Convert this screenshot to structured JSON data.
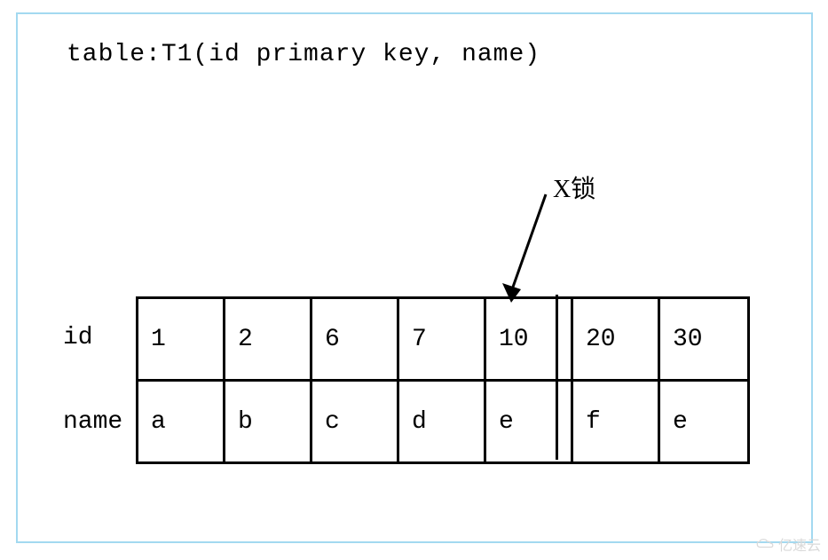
{
  "title": "table:T1(id primary key, name)",
  "lock_label": "X锁",
  "row_labels": {
    "id": "id",
    "name": "name"
  },
  "table": {
    "id_row": [
      "1",
      "2",
      "6",
      "7",
      "10",
      "20",
      "30"
    ],
    "name_row": [
      "a",
      "b",
      "c",
      "d",
      "e",
      "f",
      "e"
    ]
  },
  "watermark": "亿速云",
  "chart_data": {
    "type": "table",
    "title": "table:T1(id primary key, name)",
    "columns": [
      "id",
      "name"
    ],
    "rows": [
      {
        "id": 1,
        "name": "a"
      },
      {
        "id": 2,
        "name": "b"
      },
      {
        "id": 6,
        "name": "c"
      },
      {
        "id": 7,
        "name": "d"
      },
      {
        "id": 10,
        "name": "e"
      },
      {
        "id": 20,
        "name": "f"
      },
      {
        "id": 30,
        "name": "e"
      }
    ],
    "annotations": [
      {
        "label": "X锁",
        "target_column": "id",
        "target_value": 10,
        "meaning": "exclusive lock on row id=10"
      }
    ]
  }
}
